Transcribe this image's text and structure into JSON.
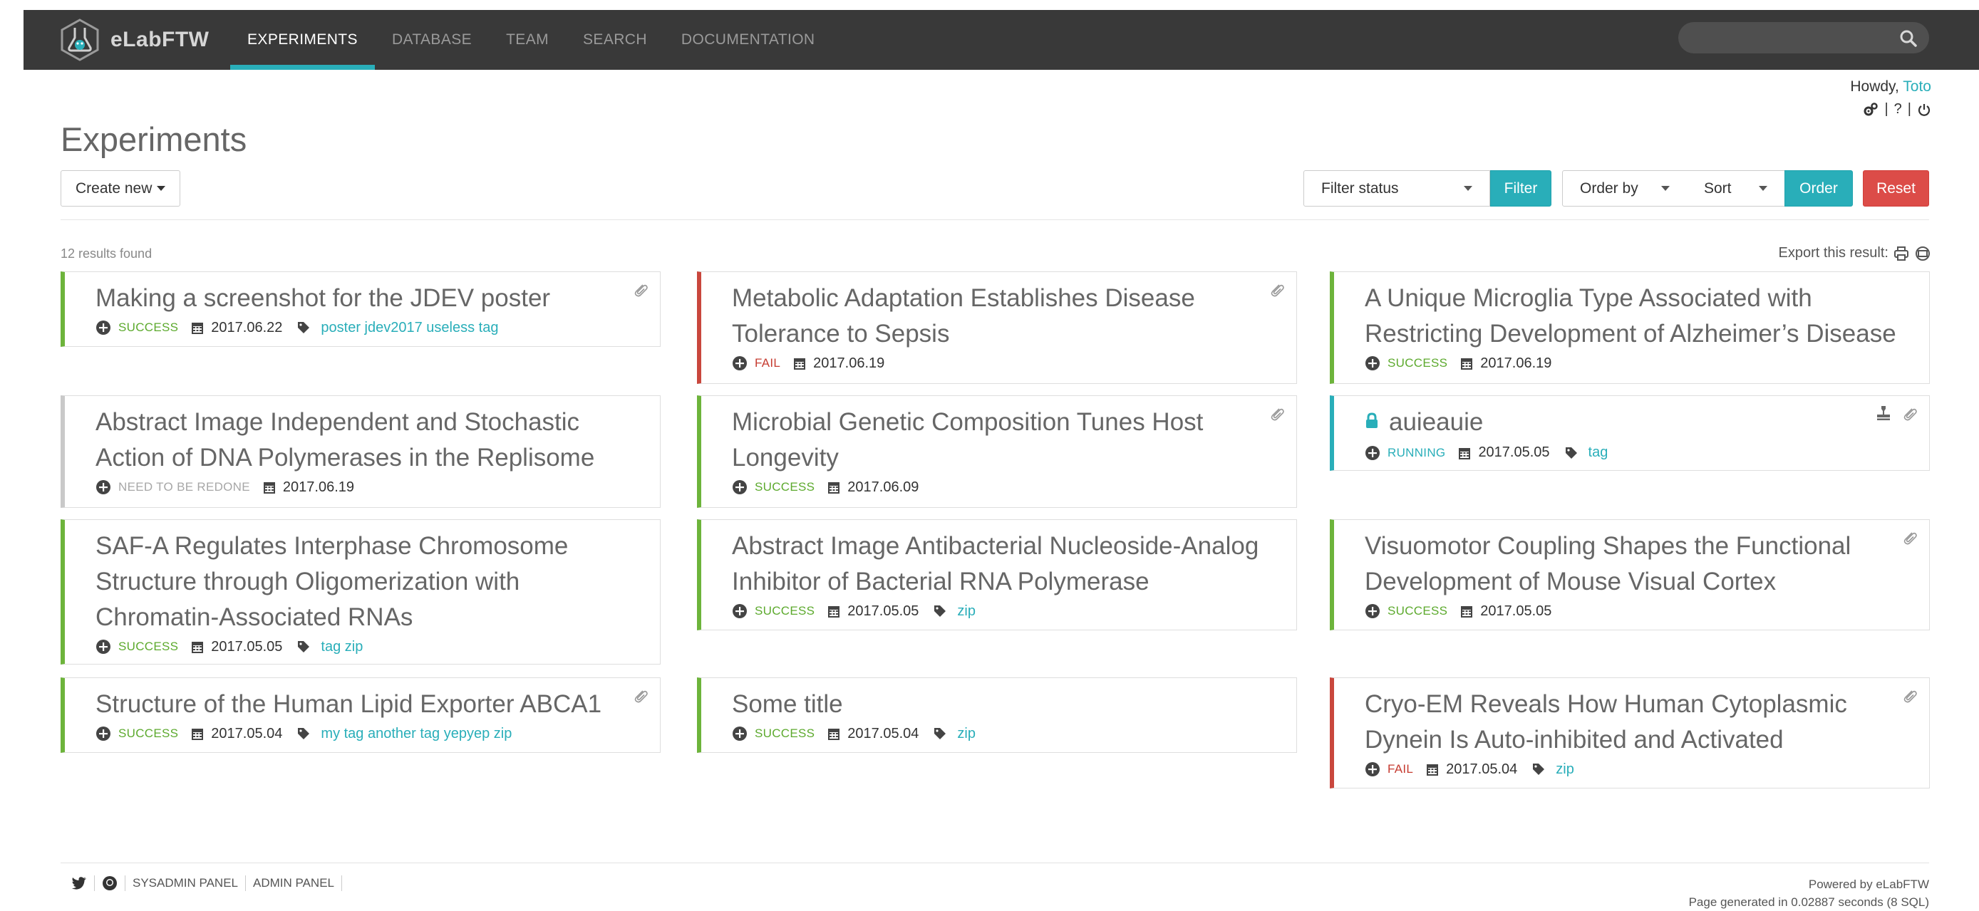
{
  "app": {
    "brand": "eLabFTW",
    "accent_color": "#29aeb9"
  },
  "nav": {
    "items": [
      {
        "label": "EXPERIMENTS",
        "active": true
      },
      {
        "label": "DATABASE",
        "active": false
      },
      {
        "label": "TEAM",
        "active": false
      },
      {
        "label": "SEARCH",
        "active": false
      },
      {
        "label": "DOCUMENTATION",
        "active": false
      }
    ],
    "search_placeholder": ""
  },
  "user": {
    "greeting": "Howdy,",
    "name": "Toto",
    "tools": {
      "settings_icon": "gears-icon",
      "help": "?",
      "logout_icon": "power-icon"
    }
  },
  "header": {
    "title": "Experiments",
    "create_new": "Create new",
    "filter_status": "Filter status",
    "filter": "Filter",
    "order_by": "Order by",
    "sort": "Sort",
    "order": "Order",
    "reset": "Reset"
  },
  "results": {
    "count_text": "12 results found",
    "export_text": "Export this result:"
  },
  "status_colors": {
    "success": "#6db43b",
    "fail": "#c9473d",
    "redone": "#c9c9c9",
    "running": "#29aeb9"
  },
  "experiments": [
    {
      "title": "Making a screenshot for the JDEV poster",
      "status": "SUCCESS",
      "status_key": "success",
      "date": "2017.06.22",
      "tags": "poster jdev2017 useless tag",
      "attachment": true
    },
    {
      "title": "Metabolic Adaptation Establishes Disease Tolerance to Sepsis",
      "status": "FAIL",
      "status_key": "fail",
      "date": "2017.06.19",
      "tags": "",
      "attachment": true
    },
    {
      "title": "A Unique Microglia Type Associated with Restricting Development of Alzheimer’s Disease",
      "status": "SUCCESS",
      "status_key": "success",
      "date": "2017.06.19",
      "tags": "",
      "attachment": false
    },
    {
      "title": "Abstract Image Independent and Stochastic Action of DNA Polymerases in the Replisome",
      "status": "NEED TO BE REDONE",
      "status_key": "redone",
      "date": "2017.06.19",
      "tags": "",
      "attachment": false
    },
    {
      "title": "Microbial Genetic Composition Tunes Host Longevity",
      "status": "SUCCESS",
      "status_key": "success",
      "date": "2017.06.09",
      "tags": "",
      "attachment": true
    },
    {
      "title": "auieauie",
      "status": "RUNNING",
      "status_key": "running",
      "date": "2017.05.05",
      "tags": "tag",
      "attachment": true,
      "locked": true
    },
    {
      "title": "SAF-A Regulates Interphase Chromosome Structure through Oligomerization with Chromatin-Associated RNAs",
      "status": "SUCCESS",
      "status_key": "success",
      "date": "2017.05.05",
      "tags": "tag zip",
      "attachment": false
    },
    {
      "title": "Abstract Image Antibacterial Nucleoside-Analog Inhibitor of Bacterial RNA Polymerase",
      "status": "SUCCESS",
      "status_key": "success",
      "date": "2017.05.05",
      "tags": "zip",
      "attachment": false
    },
    {
      "title": "Visuomotor Coupling Shapes the Functional Development of Mouse Visual Cortex",
      "status": "SUCCESS",
      "status_key": "success",
      "date": "2017.05.05",
      "tags": "",
      "attachment": true
    },
    {
      "title": "Structure of the Human Lipid Exporter ABCA1",
      "status": "SUCCESS",
      "status_key": "success",
      "date": "2017.05.04",
      "tags": "my tag another tag yepyep zip",
      "attachment": true
    },
    {
      "title": "Some title",
      "status": "SUCCESS",
      "status_key": "success",
      "date": "2017.05.04",
      "tags": "zip",
      "attachment": false
    },
    {
      "title": "Cryo-EM Reveals How Human Cytoplasmic Dynein Is Auto-inhibited and Activated",
      "status": "FAIL",
      "status_key": "fail",
      "date": "2017.05.04",
      "tags": "zip",
      "attachment": true
    }
  ],
  "footer": {
    "sysadmin": "SYSADMIN PANEL",
    "admin": "ADMIN PANEL",
    "powered": "Powered by eLabFTW",
    "generated": "Page generated in 0.02887 seconds (8 SQL)"
  }
}
